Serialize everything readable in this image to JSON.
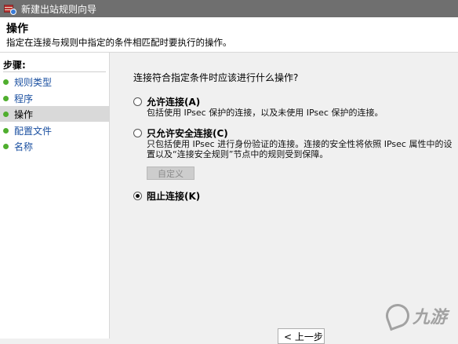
{
  "window": {
    "title": "新建出站规则向导",
    "icon": "firewall-icon"
  },
  "header": {
    "title": "操作",
    "description": "指定在连接与规则中指定的条件相匹配时要执行的操作。"
  },
  "sidebar": {
    "label": "步骤:",
    "items": [
      {
        "label": "规则类型",
        "active": false
      },
      {
        "label": "程序",
        "active": false
      },
      {
        "label": "操作",
        "active": true
      },
      {
        "label": "配置文件",
        "active": false
      },
      {
        "label": "名称",
        "active": false
      }
    ]
  },
  "main": {
    "question": "连接符合指定条件时应该进行什么操作?",
    "options": [
      {
        "label": "允许连接(A)",
        "description": [
          "包括使用 IPsec 保护的连接，以及未使用 IPsec 保护的连接。"
        ],
        "checked": false
      },
      {
        "label": "只允许安全连接(C)",
        "description": [
          "只包括使用 IPsec 进行身份验证的连接。连接的安全性将依照 IPsec 属性中的设",
          "置以及“连接安全规则”节点中的规则受到保障。"
        ],
        "checked": false
      },
      {
        "label": "阻止连接(K)",
        "description": [],
        "checked": true
      }
    ],
    "customize_label": "自定义",
    "back_label": "< 上一步"
  },
  "watermark": {
    "text": "九游"
  },
  "colors": {
    "titlebar": "#6f6f6f",
    "step_bullet": "#4fae2e",
    "link": "#1a4fa0"
  }
}
